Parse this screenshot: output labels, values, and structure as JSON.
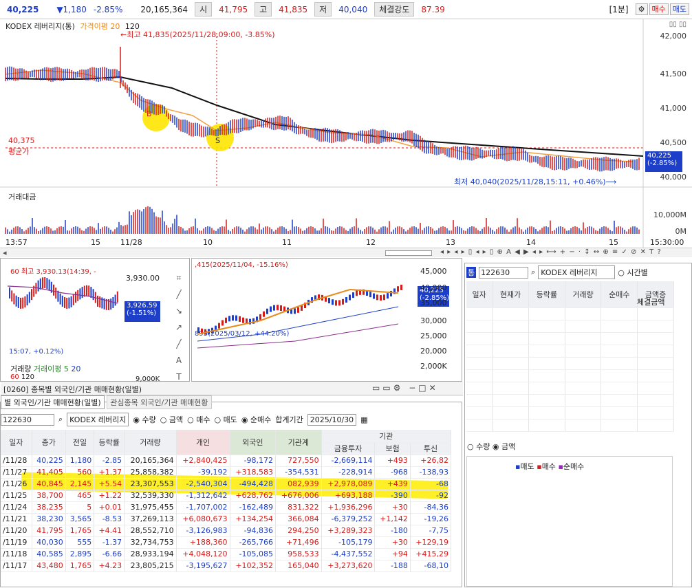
{
  "header": {
    "price": "40,225",
    "change": "▼1,180",
    "rate": "-2.85%",
    "volume": "20,165,364",
    "open_label": "시",
    "open": "41,795",
    "high_label": "고",
    "high": "41,835",
    "low_label": "저",
    "low": "40,040",
    "strength_label": "체결강도",
    "strength": "87.39",
    "interval": "[1분]",
    "sell": "매수",
    "buy": "매도"
  },
  "chart": {
    "title": "KODEX 레버리지(통)",
    "ma_label": "가격이평 20",
    "ma2": "120",
    "max_note": "←최고 41,835(2025/11/28,09:00, -3.85%)",
    "min_note": "최저 40,040(2025/11/28,15:11, +0.46%)⟶",
    "avg_price": "40,375",
    "avg_label": "평균가",
    "cur_price": "40,225",
    "cur_rate": "(-2.85%)",
    "y_ticks": [
      "42,000",
      "41,500",
      "41,000",
      "40,500",
      "40,000"
    ],
    "vol_label": "거래대금",
    "vol_ticks": [
      "10,000M",
      "0M"
    ],
    "x_ticks": [
      "13:57",
      "15",
      "11/28",
      "10",
      "11",
      "12",
      "13",
      "14",
      "15",
      "15:30:00"
    ],
    "tool_symbols": "◂ ▸ ◂ ▸ ▯ ◂ ▸ ▯ ⊕ A ◀ ▶ ◂ ▸ ⟷ + − · ↕ ↔ ⊕ ≡ ✓ ⊘ ✕ T ?"
  },
  "mini": {
    "left_price": "3,930.00",
    "left_cur": "3,926.59",
    "left_rate": "(-1.51%)",
    "left_top": "60 최고 3,930.13(14:39, -",
    "left_bot": "15:07, +0.12%)",
    "left_vol": "거래량",
    "left_ma": "거래이평 5",
    "left_ma2": "20",
    "left_vol2": "60",
    "left_vol3": "120",
    "left_ytick": "9,000K",
    "right_top": ",415(2025/11/04, -15.16%)",
    "right_cur": "40,225",
    "right_rate": "(-2.85%)",
    "right_low": "895(2025/03/12, +44.20%)",
    "right_ticks": [
      "45,000",
      "40,000",
      "35,000",
      "30,000",
      "25,000",
      "20,000",
      "2,000K"
    ]
  },
  "grid": {
    "window_title": "[0260] 종목별 외국인/기관 매매현황(일별)",
    "tab1": "별 외국인/기관 매매현황(일별)",
    "tab2": "관심종목 외국인/기관 매매현황",
    "code": "122630",
    "name": "KODEX 레버리지",
    "opt1": "수량",
    "opt2": "금액",
    "opt3": "매수",
    "opt4": "매도",
    "opt5": "순매수",
    "period_label": "합계기간",
    "date": "2025/10/30",
    "cols": [
      "일자",
      "종가",
      "전일",
      "등락률",
      "거래량",
      "개인",
      "외국인",
      "기관계",
      "금융투자",
      "보험",
      "투신"
    ],
    "group": "기관",
    "rows": [
      [
        "/11/28",
        "40,225",
        "1,180",
        "-2.85",
        "20,165,364",
        "+2,840,425",
        "-98,172",
        "727,550",
        "-2,669,114",
        "+493",
        "+26,82"
      ],
      [
        "/11/27",
        "41,405",
        "560",
        "+1.37",
        "25,858,382",
        "-39,192",
        "+318,583",
        "-354,531",
        "-228,914",
        "-968",
        "-138,93"
      ],
      [
        "/11/26",
        "40,845",
        "2,145",
        "+5.54",
        "23,307,553",
        "-2,540,304",
        "-494,428",
        "082,939",
        "+2,978,089",
        "+439",
        "-68"
      ],
      [
        "/11/25",
        "38,700",
        "465",
        "+1.22",
        "32,539,330",
        "-1,312,642",
        "+628,762",
        "+676,006",
        "+693,188",
        "-390",
        "-92"
      ],
      [
        "/11/24",
        "38,235",
        "5",
        "+0.01",
        "31,975,455",
        "-1,707,002",
        "-162,489",
        "831,322",
        "+1,936,296",
        "+30",
        "-84,36"
      ],
      [
        "/11/21",
        "38,230",
        "3,565",
        "-8.53",
        "37,269,113",
        "+6,080,673",
        "+134,254",
        "366,084",
        "-6,379,252",
        "+1,142",
        "-19,26"
      ],
      [
        "/11/20",
        "41,795",
        "1,765",
        "+4.41",
        "28,552,710",
        "-3,126,983",
        "-94,836",
        "294,250",
        "+3,289,323",
        "-180",
        "-7,75"
      ],
      [
        "/11/19",
        "40,030",
        "555",
        "-1.37",
        "32,734,753",
        "+188,360",
        "-265,766",
        "+71,496",
        "-105,179",
        "+30",
        "+129,19"
      ],
      [
        "/11/18",
        "40,585",
        "2,895",
        "-6.66",
        "28,933,194",
        "+4,048,120",
        "-105,085",
        "958,533",
        "-4,437,552",
        "+94",
        "+415,29"
      ],
      [
        "/11/17",
        "43,480",
        "1,765",
        "+4.23",
        "23,805,215",
        "-3,195,627",
        "+102,352",
        "165,040",
        "+3,273,620",
        "-188",
        "-68,10"
      ]
    ]
  },
  "right": {
    "code": "122630",
    "name": "KODEX 레버리지",
    "radio": "시간별",
    "cols": [
      "일자",
      "현재가",
      "등락률",
      "거래량",
      "순매수",
      "금액증",
      "체결금액"
    ],
    "opt1": "수량",
    "opt2": "금액",
    "legend_sell": "매도",
    "legend_buy": "매수",
    "legend_net": "순매수"
  }
}
